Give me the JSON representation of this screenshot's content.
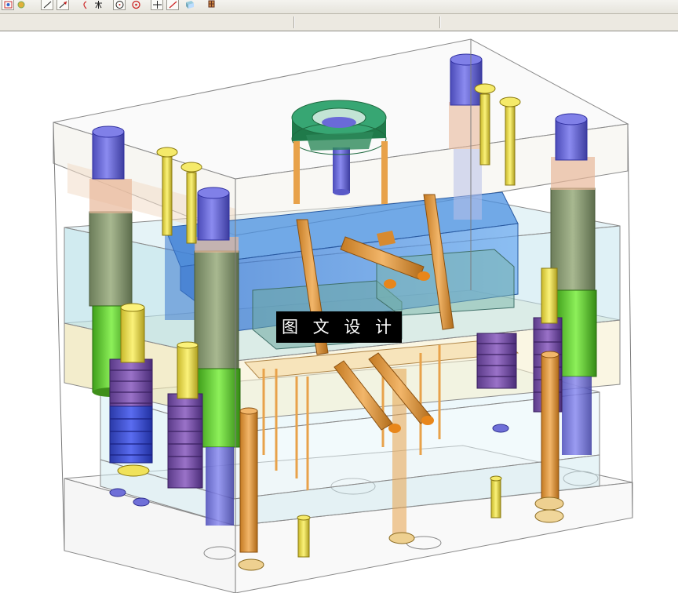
{
  "toolbar": {
    "buttons": [
      {
        "icon": "view-orient-icon"
      },
      {
        "icon": "pan-icon"
      },
      {
        "icon": "line-icon"
      },
      {
        "icon": "arrow-line-icon"
      },
      {
        "icon": "arc-icon"
      },
      {
        "icon": "snap-icon"
      },
      {
        "icon": "circle-center-icon"
      },
      {
        "icon": "target-icon"
      },
      {
        "icon": "crosshair-icon"
      },
      {
        "icon": "sketch-pen-icon"
      },
      {
        "icon": "solid-view-icon"
      },
      {
        "icon": "render-icon"
      }
    ]
  },
  "viewport": {
    "watermark_text": "图 文 设 计",
    "colors": {
      "plate_outline": "#8a8a8a",
      "top_plate": "#f3efe6",
      "cavity_plate": "#bfe3ea",
      "core_plate": "#e9e1b5",
      "support_plate": "#d6eef4",
      "guide_pillar": "#6f6fd8",
      "bushing": "#8fa27a",
      "green_bush": "#6fd43a",
      "spring": "#7a4fa8",
      "spring_blue": "#3c4fd8",
      "ejector_pin": "#e8a24a",
      "screw": "#f0e25a",
      "locating_ring": "#2f9a6a",
      "slider": "#3a7fd8"
    }
  }
}
